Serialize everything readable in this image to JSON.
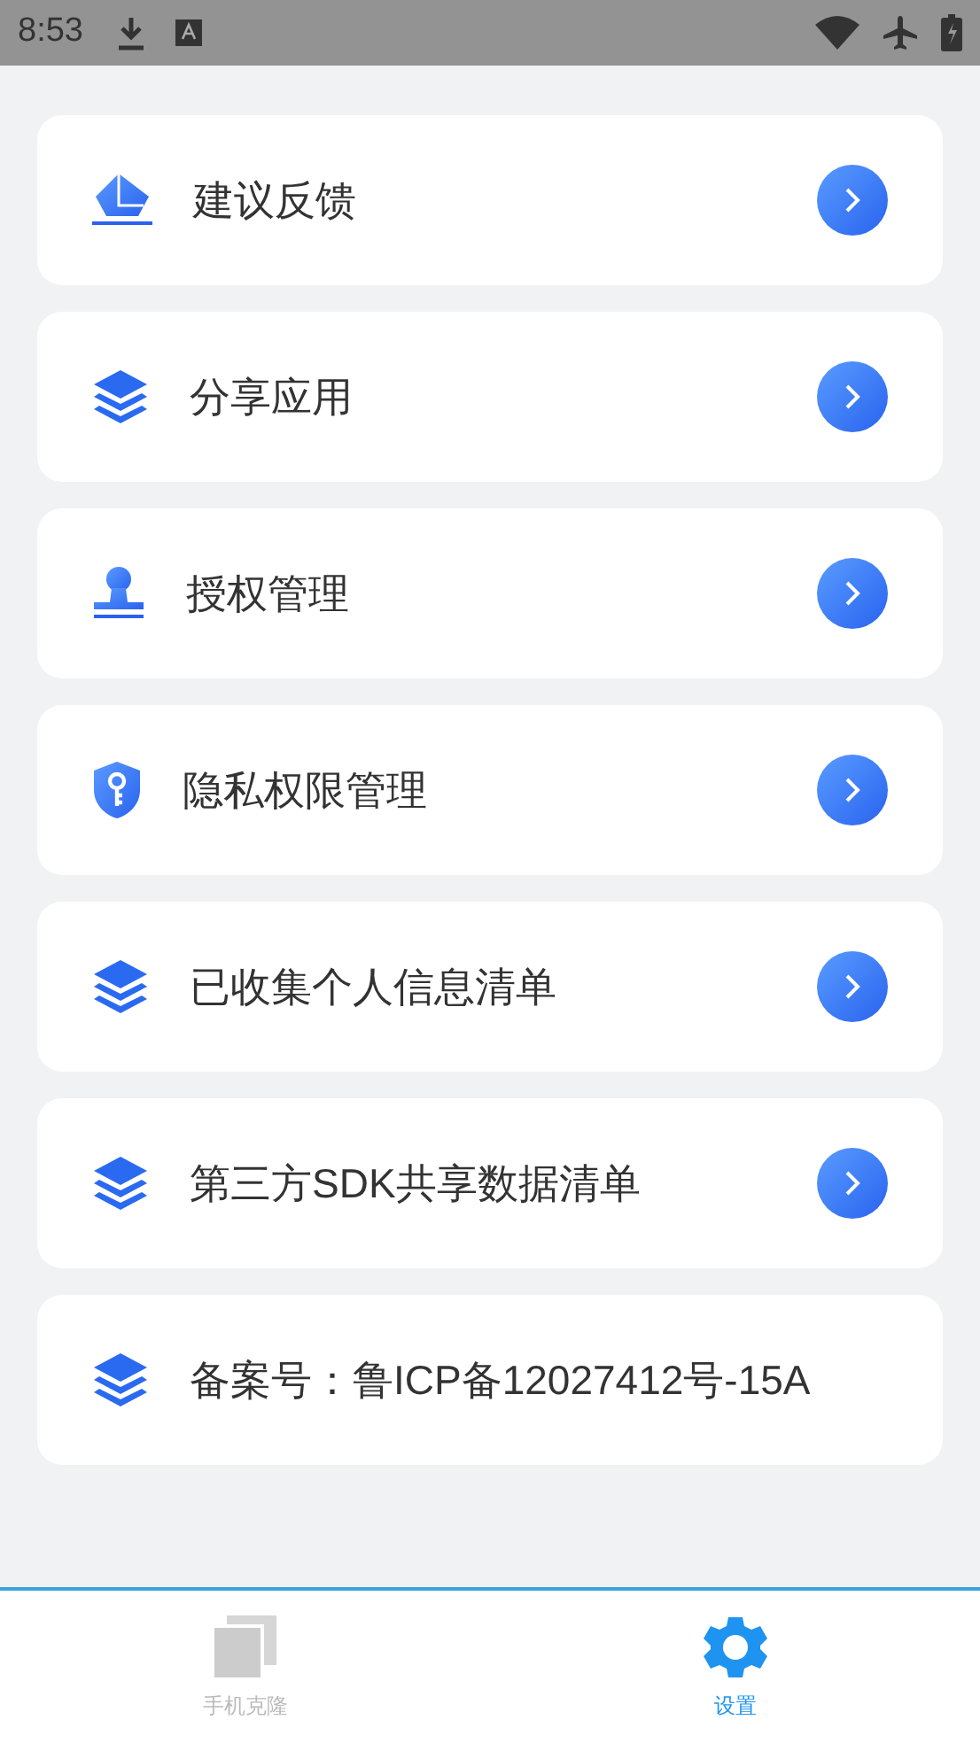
{
  "status_bar": {
    "time": "8:53"
  },
  "items": [
    {
      "label": "建议反馈",
      "kind": "feedback",
      "chevron": true
    },
    {
      "label": "分享应用",
      "kind": "layers",
      "chevron": true
    },
    {
      "label": "授权管理",
      "kind": "stamp",
      "chevron": true
    },
    {
      "label": "隐私权限管理",
      "kind": "shield",
      "chevron": true
    },
    {
      "label": "已收集个人信息清单",
      "kind": "layers",
      "chevron": true
    },
    {
      "label": "第三方SDK共享数据清单",
      "kind": "layers",
      "chevron": true
    },
    {
      "label": "备案号：鲁ICP备12027412号-15A",
      "kind": "layers",
      "chevron": false
    }
  ],
  "tabs": [
    {
      "label": "手机克隆",
      "kind": "copy",
      "selected": false
    },
    {
      "label": "设置",
      "kind": "gear",
      "selected": true
    }
  ]
}
